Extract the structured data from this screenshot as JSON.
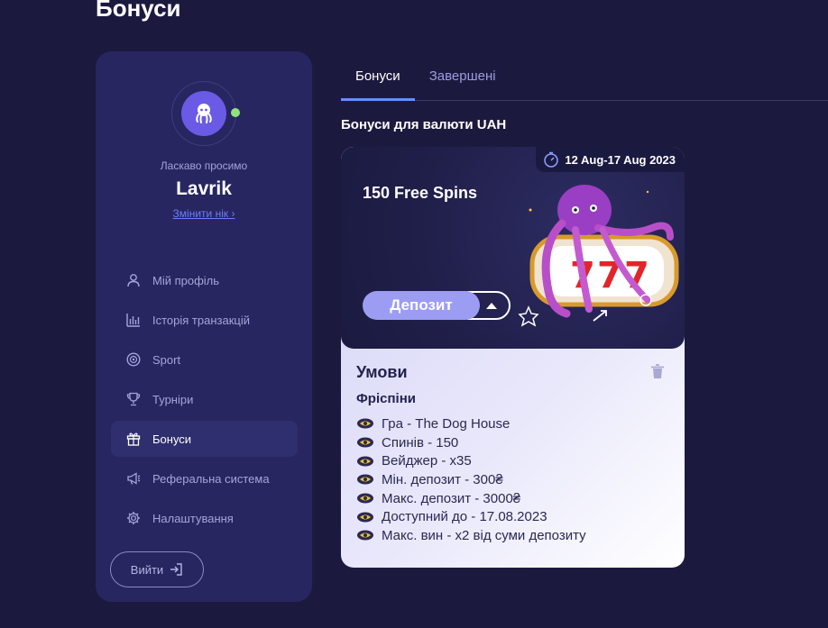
{
  "page": {
    "title": "Бонуси"
  },
  "sidebar": {
    "welcome": "Ласкаво просимо",
    "username": "Lavrik",
    "change_nick": "Змінити нік ›",
    "items": [
      {
        "label": "Мій профіль",
        "icon": "user-icon"
      },
      {
        "label": "Історія транзакцій",
        "icon": "bar-chart-icon"
      },
      {
        "label": "Sport",
        "icon": "ball-icon"
      },
      {
        "label": "Турніри",
        "icon": "trophy-icon"
      },
      {
        "label": "Бонуси",
        "icon": "gift-icon",
        "active": true
      },
      {
        "label": "Реферальна система",
        "icon": "megaphone-icon"
      },
      {
        "label": "Налаштування",
        "icon": "gear-icon"
      }
    ],
    "logout": "Вийти"
  },
  "tabs": [
    {
      "label": "Бонуси",
      "active": true
    },
    {
      "label": "Завершені",
      "active": false
    }
  ],
  "section_title": "Бонуси для валюти UAH",
  "bonus": {
    "date_range": "12 Aug-17 Aug 2023",
    "name": "150 Free Spins",
    "deposit_label": "Депозит",
    "conditions_title": "Умови",
    "conditions_subtitle": "Фріспіни",
    "conditions": [
      "Гра - The Dog House",
      "Спинів - 150",
      "Вейджер - x35",
      "Мін. депозит - 300₴",
      "Макс. депозит - 3000₴",
      "Доступний до - 17.08.2023",
      "Макс. вин - x2 від суми депозиту"
    ]
  },
  "colors": {
    "background": "#1b1a3e",
    "sidebar": "#272660",
    "accent": "#6a8cff",
    "avatar": "#6a5ae6",
    "online": "#8fe37a",
    "deposit_button": "#9c9df2"
  }
}
